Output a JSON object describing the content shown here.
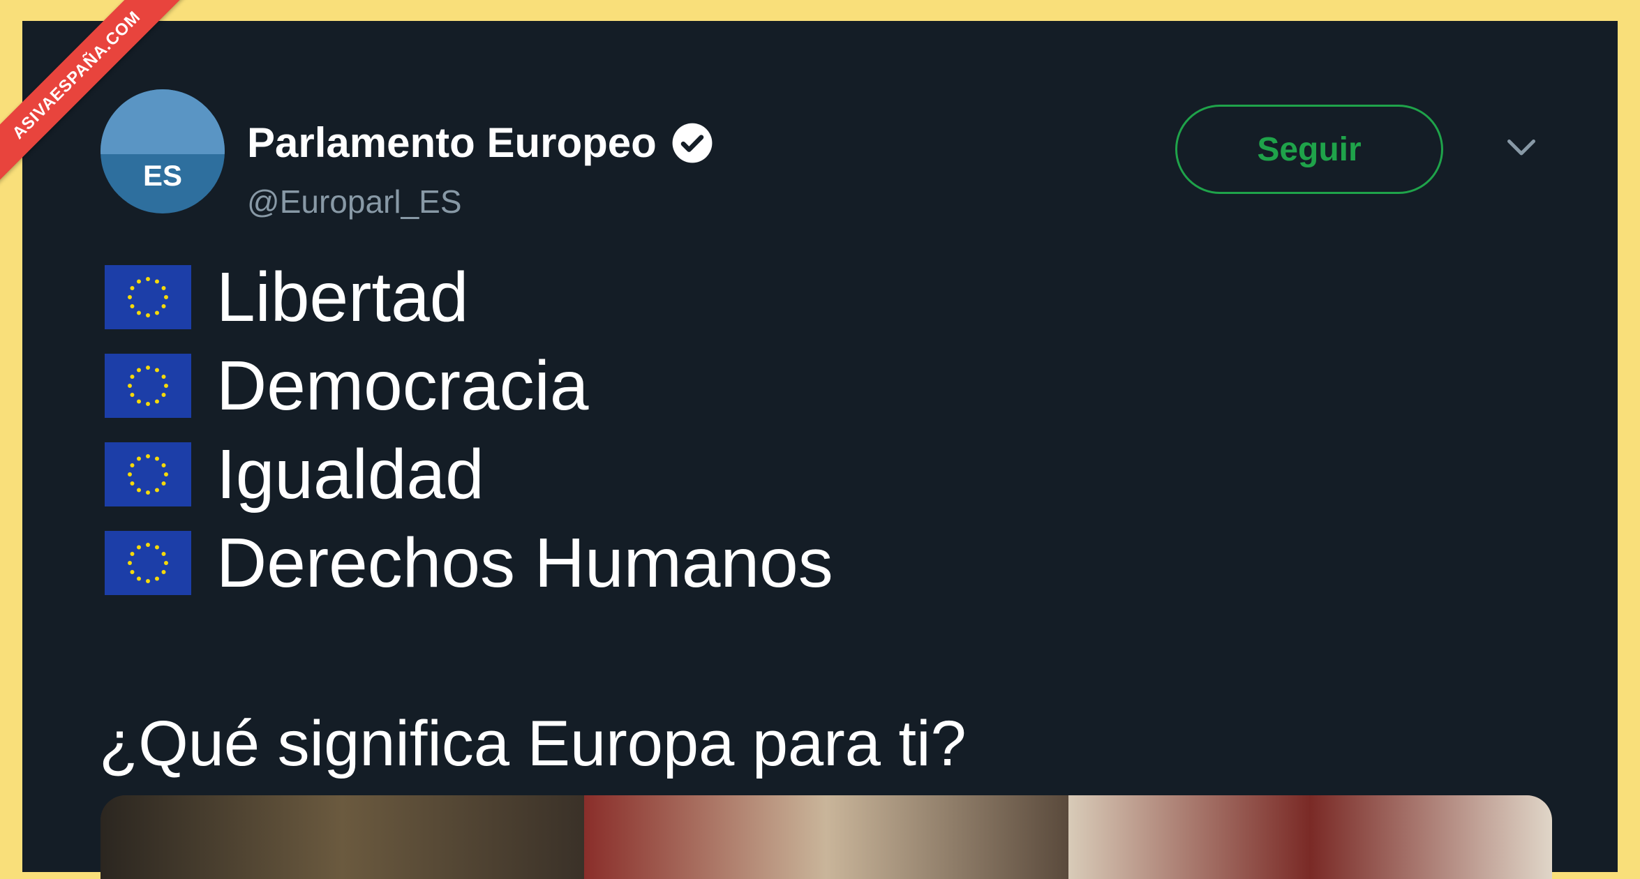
{
  "watermark": {
    "text": "ASIVAESPAÑA.COM"
  },
  "tweet": {
    "avatar_label": "ES",
    "author_name": "Parlamento Europeo",
    "handle": "@Europarl_ES",
    "follow_label": "Seguir",
    "lines": [
      "Libertad",
      "Democracia",
      "Igualdad",
      "Derechos Humanos"
    ],
    "question": "¿Qué significa Europa para ti?"
  },
  "colors": {
    "card_bg": "#141d26",
    "frame": "#f9df7a",
    "follow_green": "#1fa34a",
    "handle_gray": "#8899a6",
    "eu_flag_blue": "#1c3ea8",
    "eu_star_yellow": "#f5d90a",
    "ribbon_red": "#e8443d"
  }
}
